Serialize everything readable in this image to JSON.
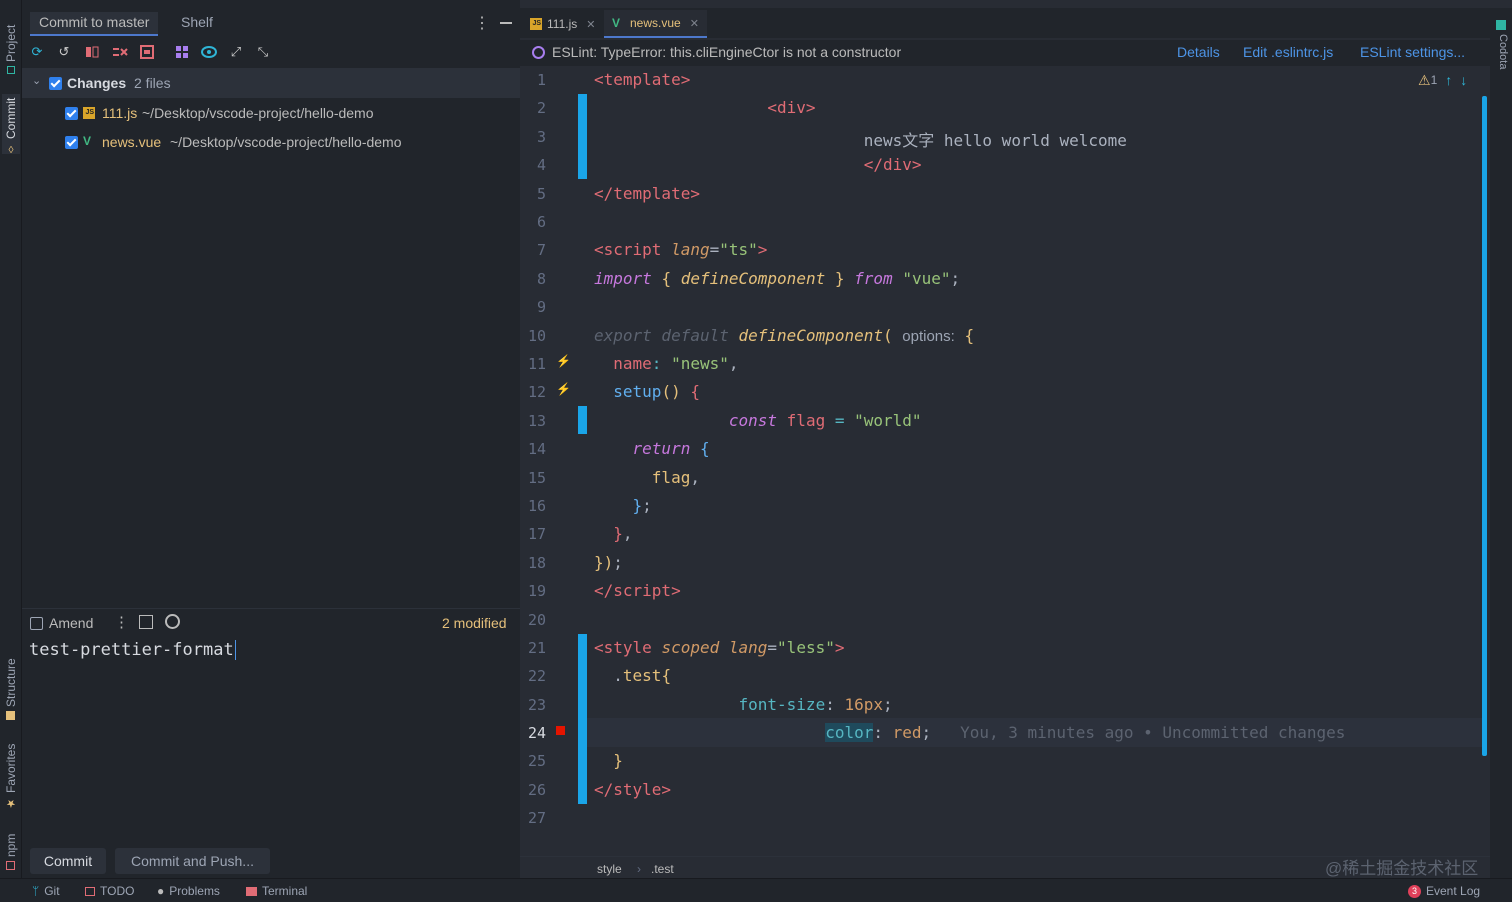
{
  "left_stripe": {
    "project": "Project",
    "commit": "Commit",
    "structure": "Structure",
    "favorites": "Favorites",
    "npm": "npm"
  },
  "commit_panel": {
    "tabs": [
      "Commit to master",
      "Shelf"
    ],
    "changes_label": "Changes",
    "changes_count": "2 files",
    "files": [
      {
        "name": "111.js",
        "path": "~/Desktop/vscode-project/hello-demo",
        "icon": "js-file-icon"
      },
      {
        "name": "news.vue",
        "path": "~/Desktop/vscode-project/hello-demo",
        "icon": "vue-file-icon"
      }
    ],
    "amend_label": "Amend",
    "modified": "2 modified",
    "message": "test-prettier-format",
    "commit_button": "Commit",
    "commit_push_button": "Commit and Push..."
  },
  "editor": {
    "tabs": [
      {
        "label": "111.js",
        "icon": "js-file-icon"
      },
      {
        "label": "news.vue",
        "icon": "vue-file-icon"
      }
    ],
    "eslint_message": "ESLint: TypeError: this.cliEngineCtor is not a constructor",
    "eslint_links": [
      "Details",
      "Edit .eslintrc.js",
      "ESLint settings..."
    ],
    "warnings": "1",
    "blame": "You, 3 minutes ago • Uncommitted changes",
    "breadcrumb": [
      "style",
      ".test"
    ],
    "current_line": "24",
    "lines": [
      "1",
      "2",
      "3",
      "4",
      "5",
      "6",
      "7",
      "8",
      "9",
      "10",
      "11",
      "12",
      "13",
      "14",
      "15",
      "16",
      "17",
      "18",
      "19",
      "20",
      "21",
      "22",
      "23",
      "24",
      "25",
      "26",
      "27"
    ]
  },
  "right_stripe": {
    "codota": "Codota"
  },
  "status_bar": {
    "git": "Git",
    "todo": "TODO",
    "problems": "Problems",
    "terminal": "Terminal",
    "event_log": "Event Log",
    "event_count": "3"
  },
  "watermark": "@稀土掘金技术社区"
}
